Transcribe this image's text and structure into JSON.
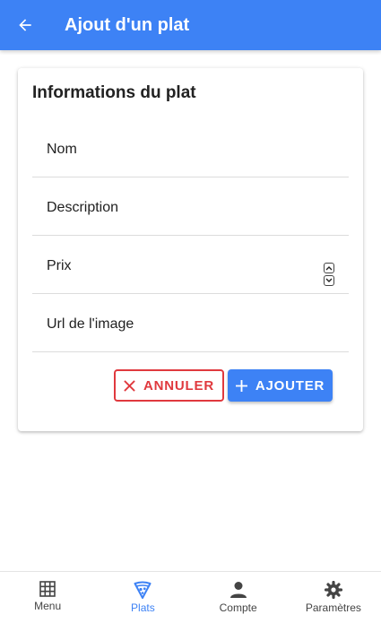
{
  "header": {
    "title": "Ajout d'un plat",
    "back_icon": "arrow-left-icon"
  },
  "card": {
    "title": "Informations du plat",
    "fields": [
      {
        "label": "Nom",
        "value": ""
      },
      {
        "label": "Description",
        "value": ""
      },
      {
        "label": "Prix",
        "value": ""
      },
      {
        "label": "Url de l'image",
        "value": ""
      }
    ],
    "cancel_label": "ANNULER",
    "add_label": "AJOUTER"
  },
  "nav": {
    "items": [
      {
        "label": "Menu",
        "icon": "grid-icon",
        "active": false
      },
      {
        "label": "Plats",
        "icon": "pizza-icon",
        "active": true
      },
      {
        "label": "Compte",
        "icon": "person-icon",
        "active": false
      },
      {
        "label": "Paramètres",
        "icon": "gear-icon",
        "active": false
      }
    ]
  },
  "colors": {
    "primary": "#3d82f5",
    "danger": "#e0393e"
  }
}
